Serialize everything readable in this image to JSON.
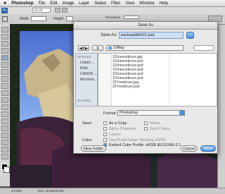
{
  "menubar": {
    "apple_glyph": "",
    "items": [
      "Photoshop",
      "File",
      "Edit",
      "Image",
      "Layer",
      "Select",
      "Filter",
      "View",
      "Window",
      "Help"
    ]
  },
  "options_bar": {
    "width_label": "Width",
    "height_label": "Height",
    "resolution_label": "Resolution",
    "zoom_value": "24.78"
  },
  "status": {
    "zoom": "24.09%",
    "doc_size": "Doc: 20.5M/20.5M"
  },
  "dialog": {
    "title": "Save As",
    "save_as_label": "Save As:",
    "filename": "packsaddle521.psd",
    "location": "10May",
    "sidebar": {
      "devices_header": "DEVICES",
      "devices": [
        "Linda's ...",
        "iDisk",
        "CANON ...",
        "Macintos..."
      ],
      "shared_header": "SHARED"
    },
    "files": [
      "115nesunbruce.jpg",
      "115nesunbruce.psd",
      "115nesunbruce.psd",
      "115nesunbruce.psd",
      "115nesunbruce.psd",
      "115nesunbruce.psd",
      "227nesbruce.jpg",
      "227nesbruce.psd"
    ],
    "format_label": "Format:",
    "format_value": "Photoshop",
    "save_label": "Save:",
    "save_options": {
      "as_a_copy": "As a Copy",
      "notes": "Notes",
      "alpha_channels": "Alpha Channels",
      "spot_colors": "Spot Colors",
      "layers": "Layers"
    },
    "color_label": "Color:",
    "color_options": {
      "use_proof_setup": "Use Proof Setup:  Working CMYK",
      "embed_profile": "Embed Color Profile:  sRGB IEC61966-2.1"
    },
    "buttons": {
      "new_folder": "New Folder",
      "cancel": "Cancel",
      "save": "Save"
    }
  },
  "colors": {
    "accent": "#4a90d9",
    "primary_button": "#4a90d9"
  }
}
